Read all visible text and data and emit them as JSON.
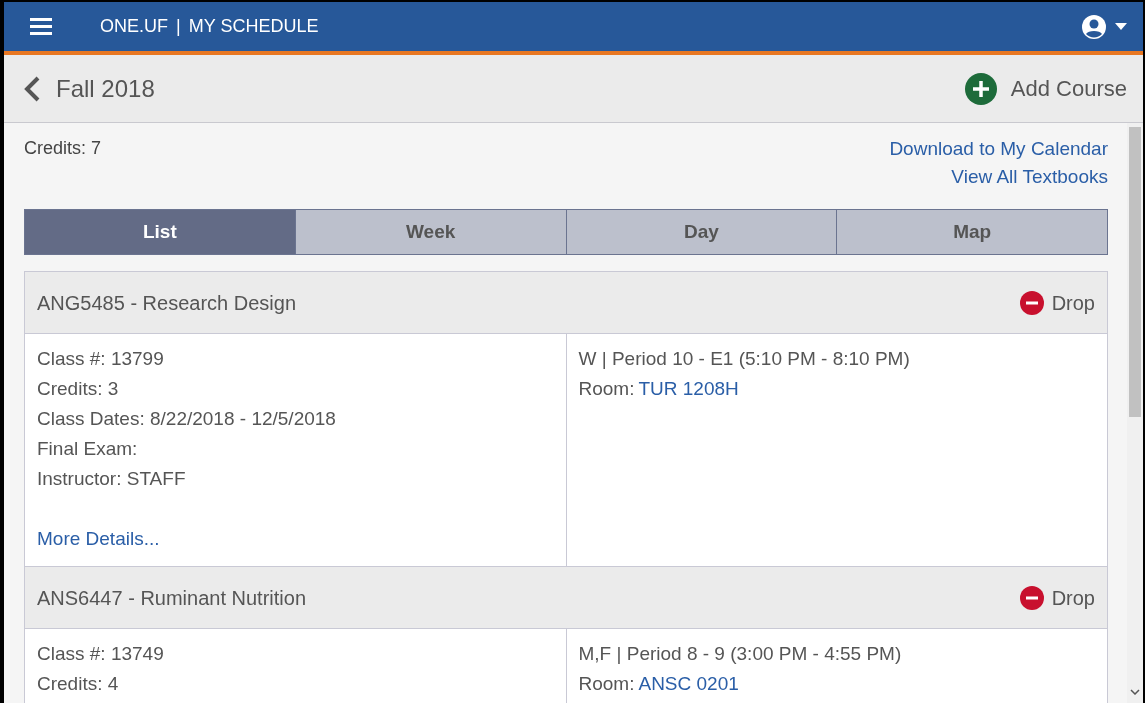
{
  "top_bar": {
    "brand": "ONE.UF",
    "separator": "|",
    "app": "MY SCHEDULE"
  },
  "term_bar": {
    "title": "Fall 2018",
    "action": "Add Course"
  },
  "summary": {
    "credits": "Credits: 7",
    "links": [
      "Download to My Calendar",
      "View All Textbooks"
    ]
  },
  "tabs": [
    {
      "label": "List",
      "selected": true
    },
    {
      "label": "Week",
      "selected": false
    },
    {
      "label": "Day",
      "selected": false
    },
    {
      "label": "Map",
      "selected": false
    }
  ],
  "courses": [
    {
      "title": "ANG5485 - Research Design",
      "action": "Drop",
      "details": [
        "Class #: 13799",
        "Credits: 3",
        "Class Dates: 8/22/2018 - 12/5/2018",
        "Final Exam:",
        "Instructor: STAFF"
      ],
      "more_link": "More Details...",
      "schedule": "W | Period 10 - E1 (5:10 PM - 8:10 PM)",
      "room_label": "Room:",
      "room": "TUR 1208H"
    },
    {
      "title": "ANS6447 - Ruminant Nutrition",
      "action": "Drop",
      "details": [
        "Class #: 13749",
        "Credits: 4"
      ],
      "schedule": "M,F | Period 8 - 9 (3:00 PM - 4:55 PM)",
      "room_label": "Room:",
      "room": "ANSC 0201"
    }
  ]
}
